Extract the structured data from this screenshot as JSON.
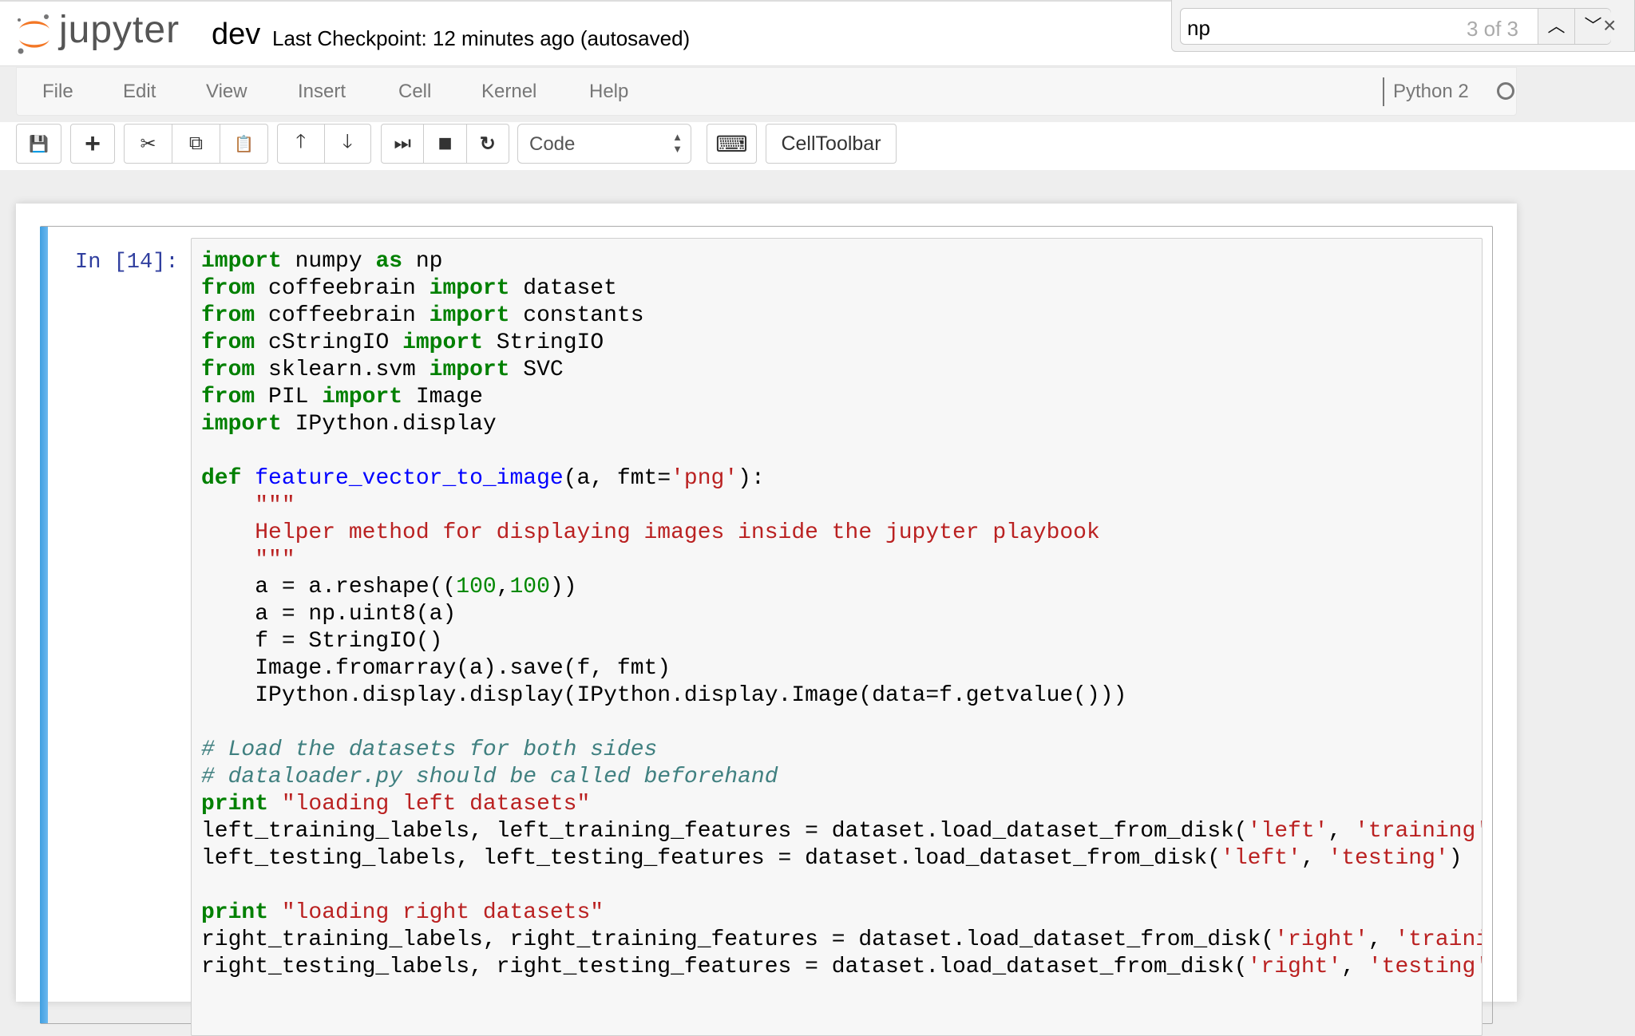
{
  "header": {
    "logo_text": "jupyter",
    "notebook_name": "dev",
    "checkpoint": "Last Checkpoint: 12 minutes ago (autosaved)",
    "logo_colors": {
      "orange": "#F37726",
      "gray": "#767677"
    }
  },
  "find": {
    "query": "np",
    "count": "3 of 3",
    "prev_icon": "chevron-up-icon",
    "next_icon": "chevron-down-icon",
    "close": "×"
  },
  "menu": {
    "items": [
      "File",
      "Edit",
      "View",
      "Insert",
      "Cell",
      "Kernel",
      "Help"
    ],
    "kernel_name": "Python 2",
    "kernel_status": "idle"
  },
  "toolbar": {
    "cell_type": "Code",
    "celltoolbar_label": "CellToolbar",
    "icons": {
      "save": "💾",
      "add": "+",
      "cut": "✂",
      "copy": "⧉",
      "paste": "📋",
      "up": "🡑",
      "down": "🡓",
      "run": "⏭",
      "stop": "■",
      "restart": "↻",
      "keyboard": "⌨"
    }
  },
  "cell": {
    "prompt": "In [14]:",
    "code": [
      [
        [
          "kw",
          "import"
        ],
        [
          "",
          "  numpy "
        ],
        [
          "kw",
          "as"
        ],
        [
          "",
          " np"
        ]
      ],
      [
        [
          "kw",
          "from"
        ],
        [
          "",
          " coffeebrain "
        ],
        [
          "kw",
          "import"
        ],
        [
          "",
          " dataset"
        ]
      ],
      [
        [
          "kw",
          "from"
        ],
        [
          "",
          " coffeebrain "
        ],
        [
          "kw",
          "import"
        ],
        [
          "",
          " constants"
        ]
      ],
      [
        [
          "kw",
          "from"
        ],
        [
          "",
          " cStringIO "
        ],
        [
          "kw",
          "import"
        ],
        [
          "",
          " StringIO"
        ]
      ],
      [
        [
          "kw",
          "from"
        ],
        [
          "",
          " sklearn.svm "
        ],
        [
          "kw",
          "import"
        ],
        [
          "",
          " SVC"
        ]
      ],
      [
        [
          "kw",
          "from"
        ],
        [
          "",
          " PIL "
        ],
        [
          "kw",
          "import"
        ],
        [
          "",
          " Image"
        ]
      ],
      [
        [
          "kw",
          "import"
        ],
        [
          "",
          " IPython.display"
        ]
      ],
      [],
      [
        [
          "kw",
          "def"
        ],
        [
          "",
          " "
        ],
        [
          "fn",
          "feature_vector_to_image"
        ],
        [
          "",
          "(a, fmt="
        ],
        [
          "st",
          "'png'"
        ],
        [
          "",
          "):"
        ]
      ],
      [
        [
          "",
          "    "
        ],
        [
          "st",
          "\"\"\""
        ]
      ],
      [
        [
          "",
          "    "
        ],
        [
          "st",
          "Helper method for displaying images inside the jupyter playbook"
        ]
      ],
      [
        [
          "",
          "    "
        ],
        [
          "st",
          "\"\"\""
        ]
      ],
      [
        [
          "",
          "    a = a.reshape(("
        ],
        [
          "nu",
          "100"
        ],
        [
          "",
          ","
        ],
        [
          "nu",
          "100"
        ],
        [
          "",
          "))"
        ]
      ],
      [
        [
          "",
          "    a = np.uint8(a)"
        ]
      ],
      [
        [
          "",
          "    f = StringIO()"
        ]
      ],
      [
        [
          "",
          "    Image.fromarray(a).save(f, fmt)"
        ]
      ],
      [
        [
          "",
          "    IPython.display.display(IPython.display.Image(data=f.getvalue()))"
        ]
      ],
      [],
      [
        [
          "cm",
          "# Load the datasets for both sides"
        ]
      ],
      [
        [
          "cm",
          "# dataloader.py should be called beforehand"
        ]
      ],
      [
        [
          "kw",
          "print"
        ],
        [
          "",
          " "
        ],
        [
          "st",
          "\"loading left datasets\""
        ]
      ],
      [
        [
          "",
          "left_training_labels, left_training_features = dataset.load_dataset_from_disk("
        ],
        [
          "st",
          "'left'"
        ],
        [
          "",
          ", "
        ],
        [
          "st",
          "'training'"
        ],
        [
          "",
          ")"
        ]
      ],
      [
        [
          "",
          "left_testing_labels, left_testing_features = dataset.load_dataset_from_disk("
        ],
        [
          "st",
          "'left'"
        ],
        [
          "",
          ", "
        ],
        [
          "st",
          "'testing'"
        ],
        [
          "",
          ")"
        ]
      ],
      [],
      [
        [
          "kw",
          "print"
        ],
        [
          "",
          " "
        ],
        [
          "st",
          "\"loading right datasets\""
        ]
      ],
      [
        [
          "",
          "right_training_labels, right_training_features = dataset.load_dataset_from_disk("
        ],
        [
          "st",
          "'right'"
        ],
        [
          "",
          ", "
        ],
        [
          "st",
          "'training'"
        ],
        [
          "",
          ")"
        ]
      ],
      [
        [
          "",
          "right_testing_labels, right_testing_features = dataset.load_dataset_from_disk("
        ],
        [
          "st",
          "'right'"
        ],
        [
          "",
          ", "
        ],
        [
          "st",
          "'testing'"
        ],
        [
          "",
          ")"
        ]
      ]
    ]
  }
}
